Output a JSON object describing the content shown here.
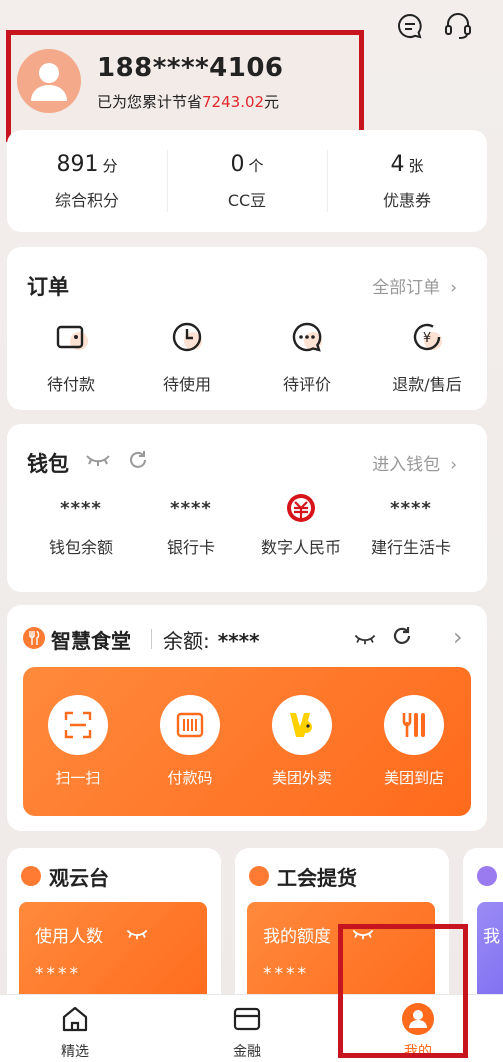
{
  "header": {
    "phone": "188****4106",
    "saved_prefix": "已为您累计节省",
    "saved_amount": "7243.02",
    "saved_suffix": "元"
  },
  "stats": [
    {
      "value": "891",
      "unit": "分",
      "label": "综合积分"
    },
    {
      "value": "0",
      "unit": "个",
      "label": "CC豆"
    },
    {
      "value": "4",
      "unit": "张",
      "label": "优惠券"
    }
  ],
  "orders": {
    "title": "订单",
    "link": "全部订单",
    "items": [
      {
        "label": "待付款",
        "icon": "wallet-icon"
      },
      {
        "label": "待使用",
        "icon": "clock-icon"
      },
      {
        "label": "待评价",
        "icon": "chat-icon"
      },
      {
        "label": "退款/售后",
        "icon": "refund-icon"
      }
    ]
  },
  "wallet": {
    "title": "钱包",
    "link": "进入钱包",
    "items": [
      {
        "value": "****",
        "label": "钱包余额"
      },
      {
        "value": "****",
        "label": "银行卡"
      },
      {
        "value": "",
        "label": "数字人民币"
      },
      {
        "value": "****",
        "label": "建行生活卡"
      }
    ]
  },
  "canteen": {
    "title": "智慧食堂",
    "balance_label": "余额:",
    "balance_value": "****",
    "actions": [
      {
        "label": "扫一扫",
        "icon": "scan-icon"
      },
      {
        "label": "付款码",
        "icon": "barcode-icon"
      },
      {
        "label": "美团外卖",
        "icon": "meituan-waimai-icon"
      },
      {
        "label": "美团到店",
        "icon": "fork-knife-icon"
      }
    ]
  },
  "mini_cards": [
    {
      "title": "观云台",
      "tile_label": "使用人数",
      "tile_value": "****"
    },
    {
      "title": "工会提货",
      "tile_label": "我的额度",
      "tile_value": "****"
    },
    {
      "title": "",
      "tile_label": "我",
      "tile_value": ""
    }
  ],
  "nav": [
    {
      "label": "精选",
      "icon": "home-icon"
    },
    {
      "label": "金融",
      "icon": "card-icon"
    },
    {
      "label": "我的",
      "icon": "profile-icon"
    }
  ],
  "colors": {
    "accent": "#ff6a1c",
    "highlight_red": "#c8141e",
    "amount_red": "#e0282e"
  }
}
